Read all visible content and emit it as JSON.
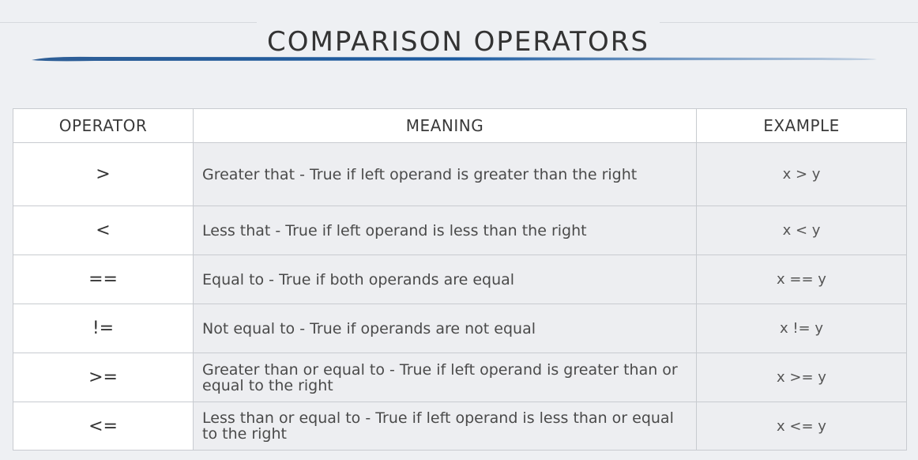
{
  "title": "COMPARISON OPERATORS",
  "colors": {
    "accent": "#1a5aa0",
    "background": "#eef0f3",
    "header_bg": "#ffffff",
    "cell_bg": "#edeef1",
    "border": "#c8cbd0"
  },
  "table": {
    "headers": [
      "OPERATOR",
      "MEANING",
      "EXAMPLE"
    ],
    "rows": [
      {
        "operator": ">",
        "meaning": "Greater that - True if left operand is greater than the right",
        "example": "x > y"
      },
      {
        "operator": "<",
        "meaning": "Less that - True if left operand is less than the right",
        "example": "x < y"
      },
      {
        "operator": "==",
        "meaning": "Equal to - True if both operands are equal",
        "example": "x == y"
      },
      {
        "operator": "!=",
        "meaning": "Not equal to - True if operands are not equal",
        "example": "x != y"
      },
      {
        "operator": ">=",
        "meaning": "Greater than or equal to - True if left operand is greater than or equal to the right",
        "example": "x >= y"
      },
      {
        "operator": "<=",
        "meaning": "Less than or equal to - True if left operand is less than or equal to the right",
        "example": "x <= y"
      }
    ]
  }
}
